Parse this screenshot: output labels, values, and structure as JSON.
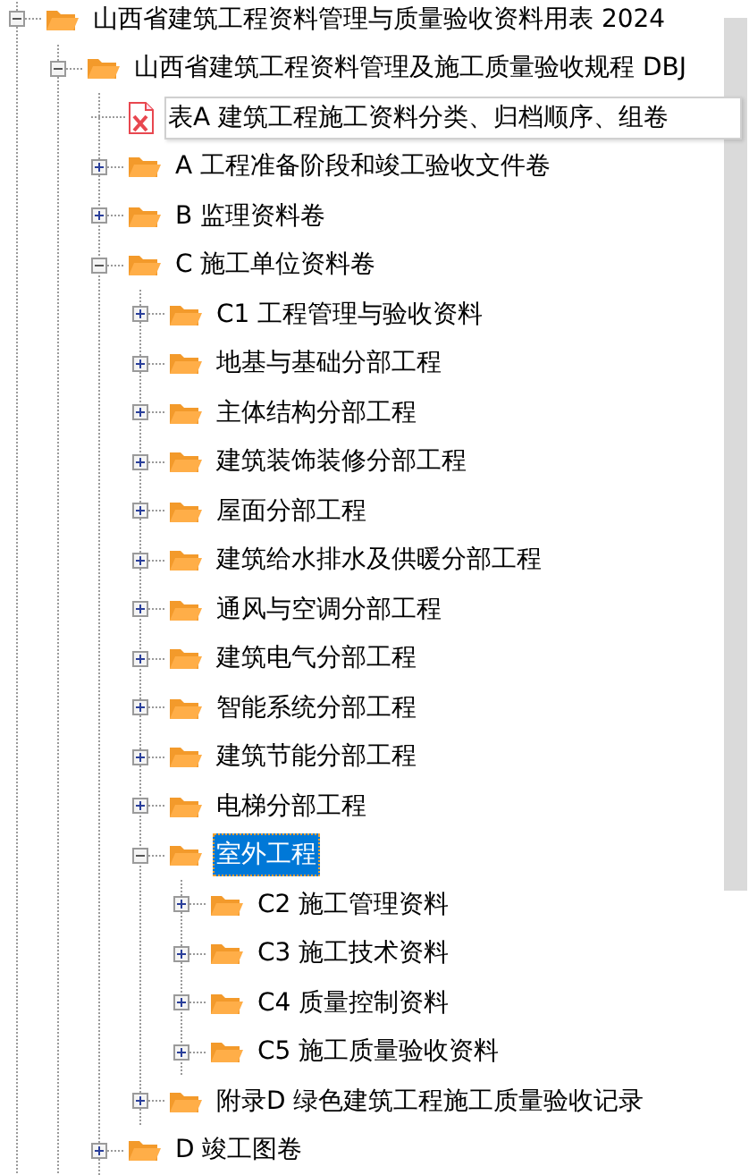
{
  "tree": [
    {
      "label": "山西省建筑工程资料管理与质量验收资料用表 2024",
      "kind": "folder",
      "expanded": true,
      "selected": false,
      "children": [
        {
          "label": "山西省建筑工程资料管理及施工质量验收规程 DBJ",
          "kind": "folder",
          "expanded": true,
          "selected": false,
          "children": [
            {
              "label": "表A 建筑工程施工资料分类、归档顺序、组卷",
              "kind": "file"
            },
            {
              "label": "A 工程准备阶段和竣工验收文件卷",
              "kind": "folder",
              "expanded": false,
              "selected": false
            },
            {
              "label": "B 监理资料卷",
              "kind": "folder",
              "expanded": false,
              "selected": false
            },
            {
              "label": "C 施工单位资料卷",
              "kind": "folder",
              "expanded": true,
              "selected": false,
              "children": [
                {
                  "label": "C1 工程管理与验收资料",
                  "kind": "folder",
                  "expanded": false,
                  "selected": false
                },
                {
                  "label": "地基与基础分部工程",
                  "kind": "folder",
                  "expanded": false,
                  "selected": false
                },
                {
                  "label": "主体结构分部工程",
                  "kind": "folder",
                  "expanded": false,
                  "selected": false
                },
                {
                  "label": "建筑装饰装修分部工程",
                  "kind": "folder",
                  "expanded": false,
                  "selected": false
                },
                {
                  "label": "屋面分部工程",
                  "kind": "folder",
                  "expanded": false,
                  "selected": false
                },
                {
                  "label": "建筑给水排水及供暖分部工程",
                  "kind": "folder",
                  "expanded": false,
                  "selected": false
                },
                {
                  "label": "通风与空调分部工程",
                  "kind": "folder",
                  "expanded": false,
                  "selected": false
                },
                {
                  "label": "建筑电气分部工程",
                  "kind": "folder",
                  "expanded": false,
                  "selected": false
                },
                {
                  "label": "智能系统分部工程",
                  "kind": "folder",
                  "expanded": false,
                  "selected": false
                },
                {
                  "label": "建筑节能分部工程",
                  "kind": "folder",
                  "expanded": false,
                  "selected": false
                },
                {
                  "label": "电梯分部工程",
                  "kind": "folder",
                  "expanded": false,
                  "selected": false
                },
                {
                  "label": "室外工程",
                  "kind": "folder",
                  "expanded": true,
                  "selected": true,
                  "children": [
                    {
                      "label": "C2 施工管理资料",
                      "kind": "folder",
                      "expanded": false,
                      "selected": false
                    },
                    {
                      "label": "C3 施工技术资料",
                      "kind": "folder",
                      "expanded": false,
                      "selected": false
                    },
                    {
                      "label": "C4 质量控制资料",
                      "kind": "folder",
                      "expanded": false,
                      "selected": false
                    },
                    {
                      "label": "C5 施工质量验收资料",
                      "kind": "folder",
                      "expanded": false,
                      "selected": false
                    }
                  ]
                },
                {
                  "label": "附录D 绿色建筑工程施工质量验收记录",
                  "kind": "folder",
                  "expanded": false,
                  "selected": false
                }
              ]
            },
            {
              "label": "D 竣工图卷",
              "kind": "folder",
              "expanded": false,
              "selected": false
            }
          ]
        }
      ]
    }
  ]
}
